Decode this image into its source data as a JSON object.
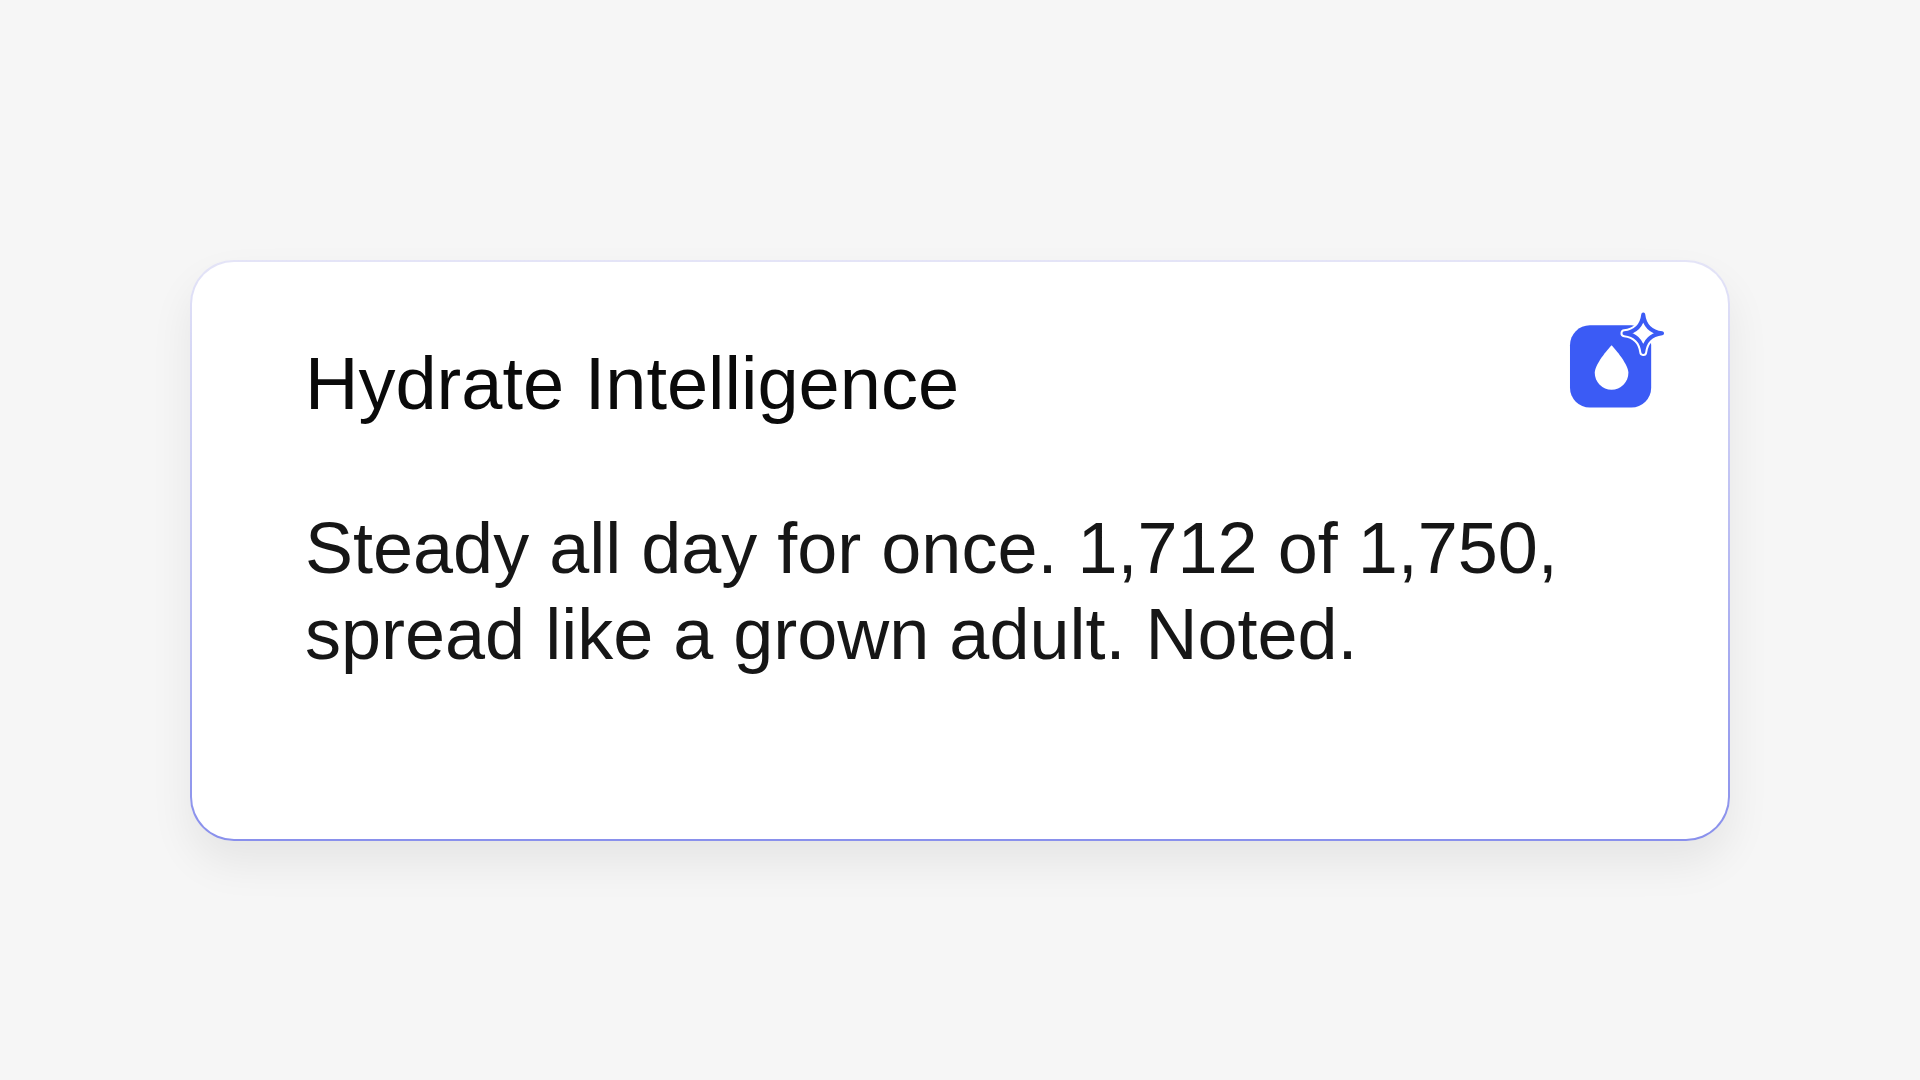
{
  "card": {
    "title": "Hydrate Intelligence",
    "message": "Steady all day for once. 1,712 of 1,750, spread like a grown adult. Noted."
  }
}
